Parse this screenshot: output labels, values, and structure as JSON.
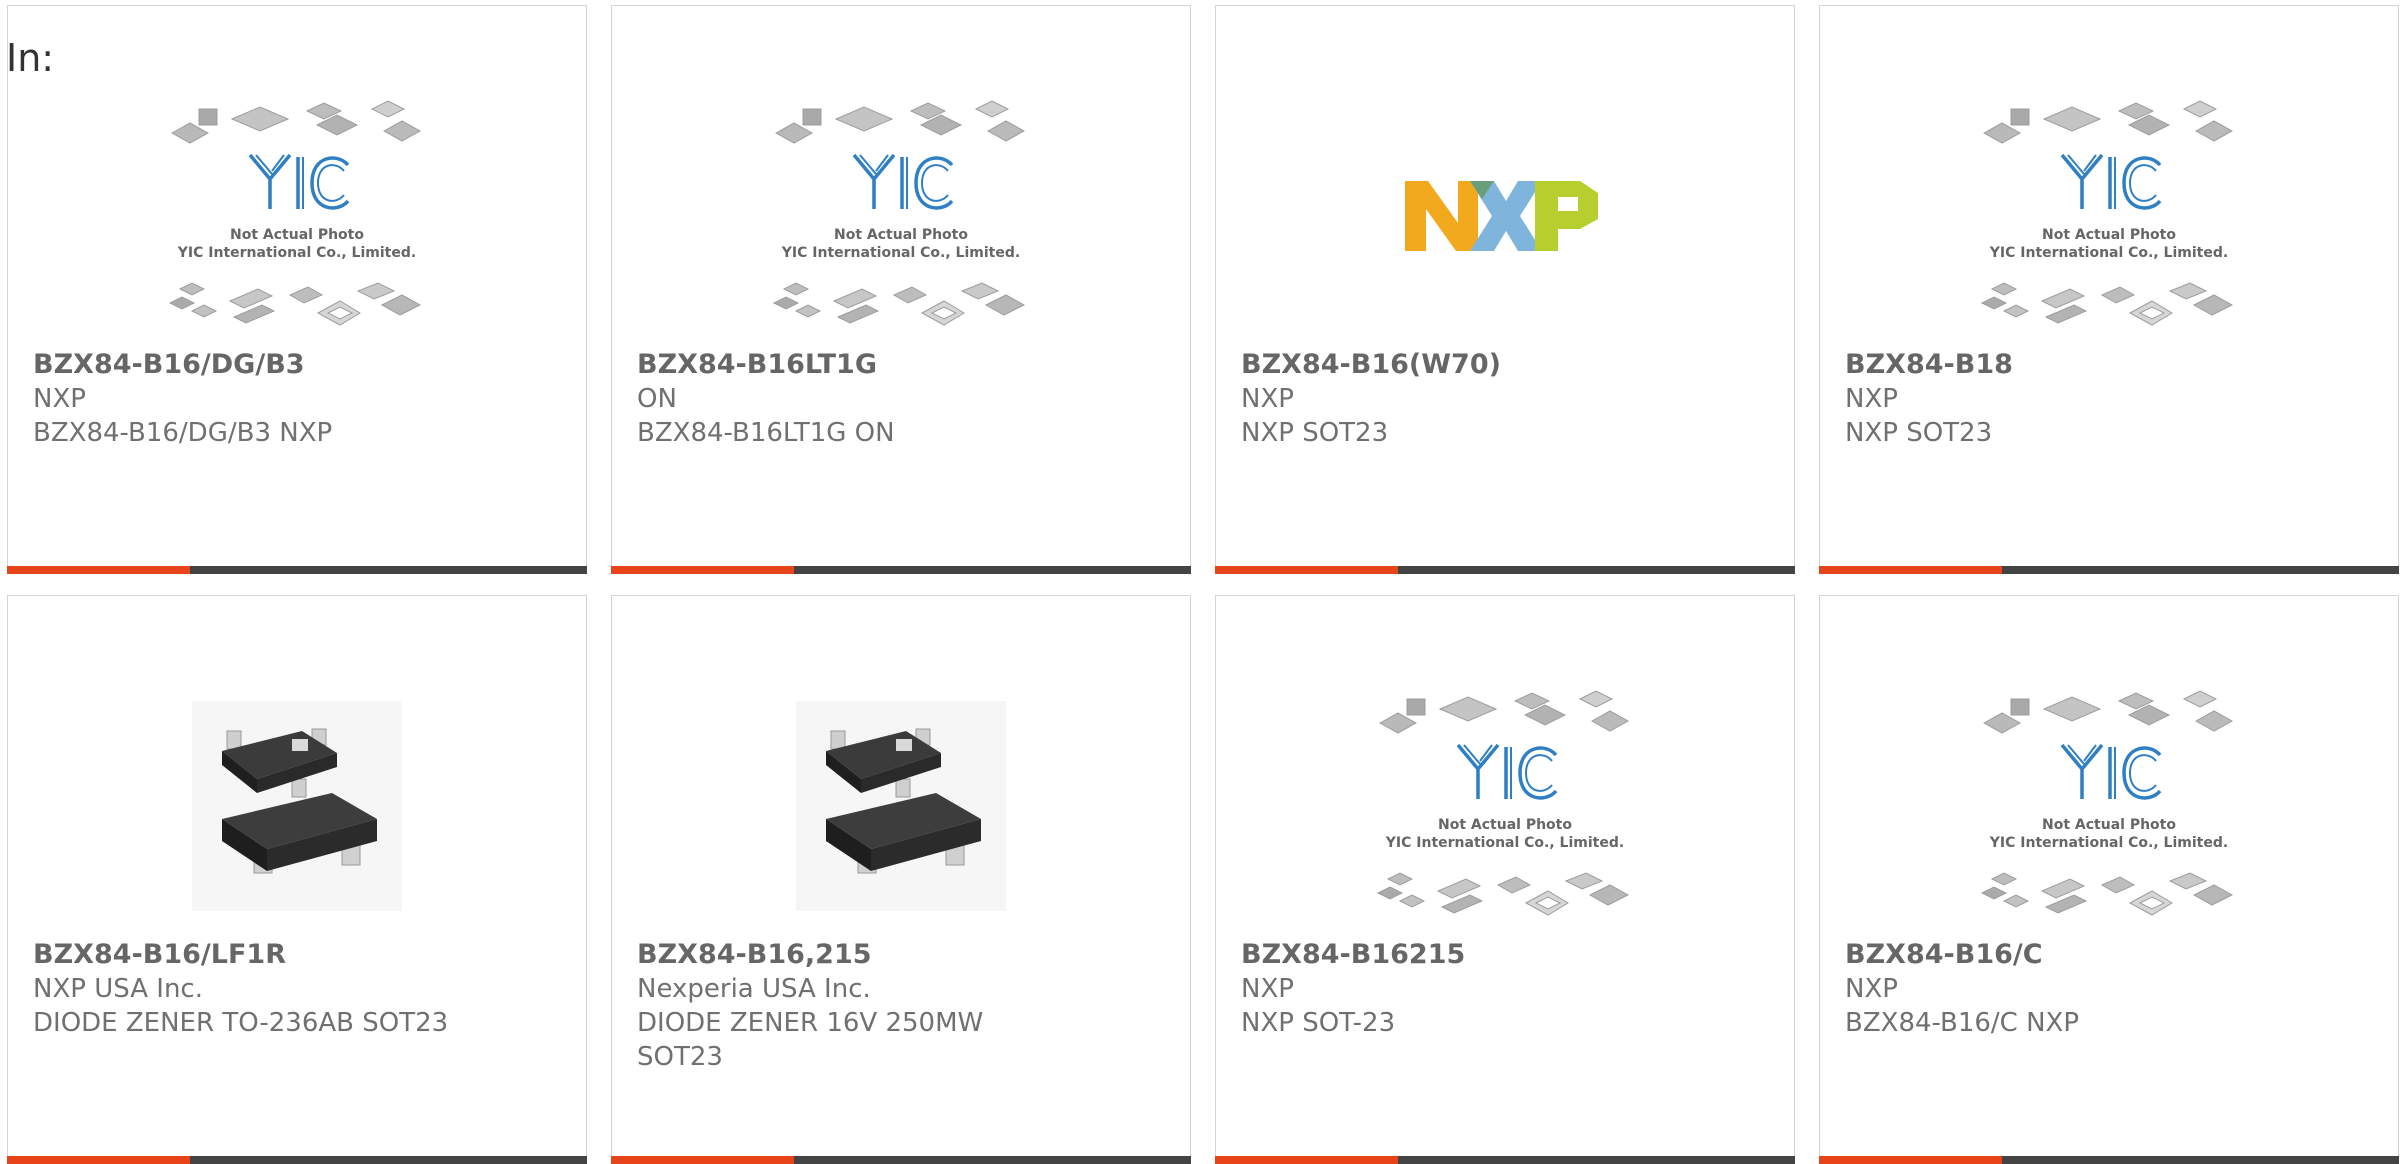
{
  "header": {
    "label": "In:"
  },
  "colors": {
    "accent": "#e8441a",
    "bar": "#444444",
    "yic_blue": "#2f7fc4"
  },
  "placeholder": {
    "caption_line1": "Not Actual Photo",
    "caption_line2": "YIC International Co., Limited.",
    "logo_text": "YIC"
  },
  "products": [
    {
      "part": "BZX84-B16/DG/B3",
      "manufacturer": "NXP",
      "desc1": "BZX84-B16/DG/B3 NXP",
      "desc2": "",
      "image": "yic-placeholder"
    },
    {
      "part": "BZX84-B16LT1G",
      "manufacturer": "ON",
      "desc1": "BZX84-B16LT1G ON",
      "desc2": "",
      "image": "yic-placeholder"
    },
    {
      "part": "BZX84-B16(W70)",
      "manufacturer": "NXP",
      "desc1": "NXP SOT23",
      "desc2": "",
      "image": "nxp-logo"
    },
    {
      "part": "BZX84-B18",
      "manufacturer": "NXP",
      "desc1": "NXP SOT23",
      "desc2": "",
      "image": "yic-placeholder"
    },
    {
      "part": "BZX84-B16/LF1R",
      "manufacturer": "NXP USA Inc.",
      "desc1": "DIODE ZENER TO-236AB SOT23",
      "desc2": "",
      "image": "sot23-photo"
    },
    {
      "part": "BZX84-B16,215",
      "manufacturer": "Nexperia USA Inc.",
      "desc1": "DIODE ZENER 16V 250MW",
      "desc2": "SOT23",
      "image": "sot23-photo"
    },
    {
      "part": "BZX84-B16215",
      "manufacturer": "NXP",
      "desc1": "NXP SOT-23",
      "desc2": "",
      "image": "yic-placeholder"
    },
    {
      "part": "BZX84-B16/C",
      "manufacturer": "NXP",
      "desc1": "BZX84-B16/C NXP",
      "desc2": "",
      "image": "yic-placeholder"
    }
  ]
}
